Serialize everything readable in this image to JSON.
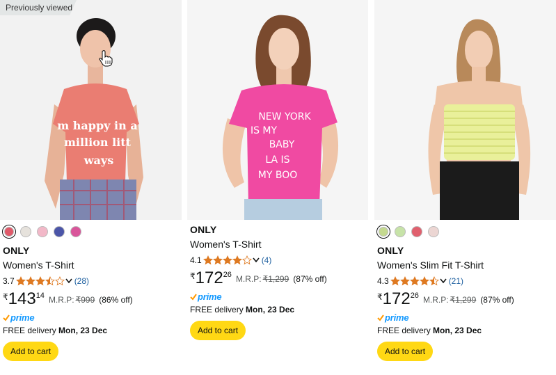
{
  "products": [
    {
      "badge": "Previously viewed",
      "shirt_color": "#ea7d72",
      "shirt_text": [
        "m happy in a",
        "million litt",
        "ways"
      ],
      "swatches": [
        "#e05a6a",
        "#e6e2dc",
        "#f2b8c8",
        "#4b55a8",
        "#d9559a"
      ],
      "brand": "ONLY",
      "title": "Women's T-Shirt",
      "rating": "3.7",
      "stars_filled": 3.5,
      "review_count": "(28)",
      "currency": "₹",
      "price_whole": "143",
      "price_fraction": "14",
      "mrp_label": "M.R.P:",
      "mrp_value": "₹999",
      "discount": "(86% off)",
      "prime": "prime",
      "delivery_prefix": "FREE delivery",
      "delivery_date": "Mon, 23 Dec",
      "add_to_cart": "Add to cart"
    },
    {
      "shirt_color": "#f04aa2",
      "shirt_text": [
        "NEW YORK",
        "IS MY",
        "BABY",
        "LA IS",
        "MY BOO"
      ],
      "brand": "ONLY",
      "title": "Women's T-Shirt",
      "rating": "4.1",
      "stars_filled": 4,
      "review_count": "(4)",
      "currency": "₹",
      "price_whole": "172",
      "price_fraction": "26",
      "mrp_label": "M.R.P:",
      "mrp_value": "₹1,299",
      "discount": "(87% off)",
      "prime": "prime",
      "delivery_prefix": "FREE delivery",
      "delivery_date": "Mon, 23 Dec",
      "add_to_cart": "Add to cart"
    },
    {
      "shirt_color": "#e9f09a",
      "swatches": [
        "#c4d98f",
        "#c7e3a8",
        "#e0606e",
        "#ecd6d3"
      ],
      "brand": "ONLY",
      "title": "Women's Slim Fit T-Shirt",
      "rating": "4.3",
      "stars_filled": 4.5,
      "review_count": "(21)",
      "currency": "₹",
      "price_whole": "172",
      "price_fraction": "26",
      "mrp_label": "M.R.P:",
      "mrp_value": "₹1,299",
      "discount": "(87% off)",
      "prime": "prime",
      "delivery_prefix": "FREE delivery",
      "delivery_date": "Mon, 23 Dec",
      "add_to_cart": "Add to cart"
    }
  ],
  "colors": {
    "star": "#de7921",
    "link": "#2162a1",
    "prime": "#1399ff",
    "button": "#ffd814"
  }
}
